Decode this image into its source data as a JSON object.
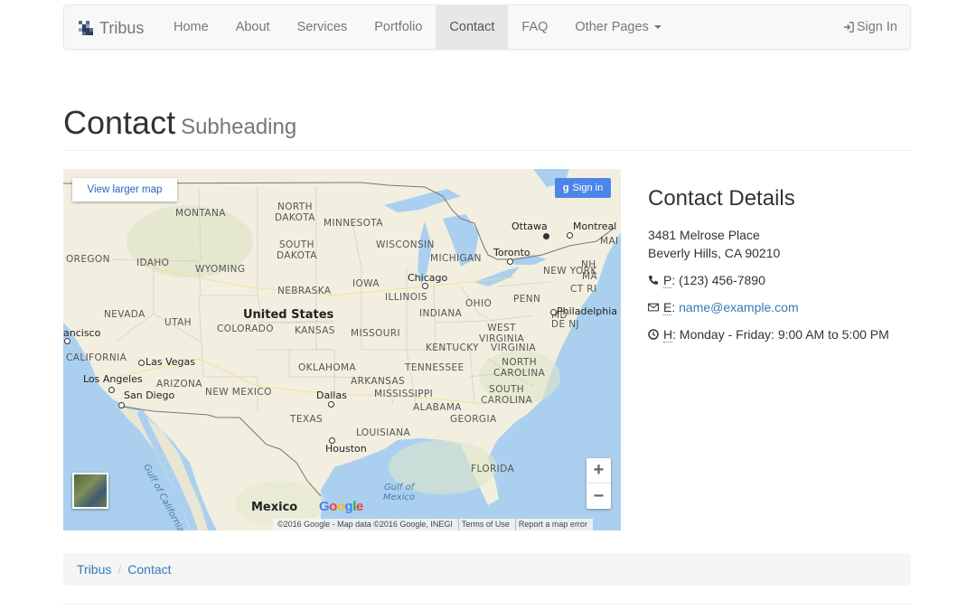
{
  "navbar": {
    "brand": "Tribus",
    "items": [
      {
        "label": "Home"
      },
      {
        "label": "About"
      },
      {
        "label": "Services"
      },
      {
        "label": "Portfolio"
      },
      {
        "label": "Contact"
      },
      {
        "label": "FAQ"
      },
      {
        "label": "Other Pages"
      }
    ],
    "active": "Contact",
    "sign_in": "Sign In"
  },
  "header": {
    "title": "Contact",
    "subtitle": "Subheading"
  },
  "map": {
    "view_larger": "View larger map",
    "sign_in": "Sign in",
    "zoom_in": "+",
    "zoom_out": "−",
    "google": "Google",
    "attribution": "©2016 Google - Map data ©2016 Google, INEGI",
    "terms": "Terms of Use",
    "report": "Report a map error",
    "labels": {
      "north_dakota": "NORTH\nDAKOTA",
      "montana": "MONTANA",
      "minnesota": "MINNESOTA",
      "south_dakota": "SOUTH\nDAKOTA",
      "wisconsin": "WISCONSIN",
      "oregon": "OREGON",
      "idaho": "IDAHO",
      "wyoming": "WYOMING",
      "michigan": "MICHIGAN",
      "iowa": "IOWA",
      "nebraska": "NEBRASKA",
      "illinois": "ILLINOIS",
      "ohio": "OHIO",
      "penn": "PENN",
      "new_york": "NEW YORK",
      "nh": "NH",
      "ma": "MA",
      "ct_ri": "CT RI",
      "nevada": "NEVADA",
      "utah": "UTAH",
      "colorado": "COLORADO",
      "kansas": "KANSAS",
      "missouri": "MISSOURI",
      "indiana": "INDIANA",
      "west_virginia": "WEST\nVIRGINIA",
      "md_dej": "MD\nDE NJ",
      "kentucky": "KENTUCKY",
      "virginia": "VIRGINIA",
      "california": "CALIFORNIA",
      "oklahoma": "OKLAHOMA",
      "tennessee": "TENNESSEE",
      "north_carolina": "NORTH\nCAROLINA",
      "arizona": "ARIZONA",
      "new_mexico": "NEW MEXICO",
      "arkansas": "ARKANSAS",
      "mississippi": "MISSISSIPPI",
      "south_carolina": "SOUTH\nCAROLINA",
      "alabama": "ALABAMA",
      "georgia": "GEORGIA",
      "texas": "TEXAS",
      "louisiana": "LOUISIANA",
      "florida": "FLORIDA",
      "united_states": "United States",
      "mexico": "Mexico",
      "gulf_california": "Gulf of California",
      "gulf_mexico": "Gulf of\nMexico",
      "ottawa": "Ottawa",
      "montreal": "Montreal",
      "toronto": "Toronto",
      "chicago": "Chicago",
      "philadelphia": "Philadelphia",
      "las_vegas": "Las Vegas",
      "los_angeles": "Los Angeles",
      "san_diego": "San Diego",
      "dallas": "Dallas",
      "houston": "Houston",
      "sf": "ancisco",
      "mai": "MAI"
    }
  },
  "contact": {
    "heading": "Contact Details",
    "address_line1": "3481 Melrose Place",
    "address_line2": "Beverly Hills, CA 90210",
    "phone_label": "P",
    "phone": "(123) 456-7890",
    "email_label": "E",
    "email": "name@example.com",
    "hours_label": "H",
    "hours": "Monday - Friday: 9:00 AM to 5:00 PM"
  },
  "breadcrumb": {
    "home": "Tribus",
    "current": "Contact"
  },
  "colors": {
    "link": "#337ab7",
    "navbar_bg": "#f8f8f8",
    "map_land": "#f2efe0",
    "map_water": "#abd0ef"
  }
}
